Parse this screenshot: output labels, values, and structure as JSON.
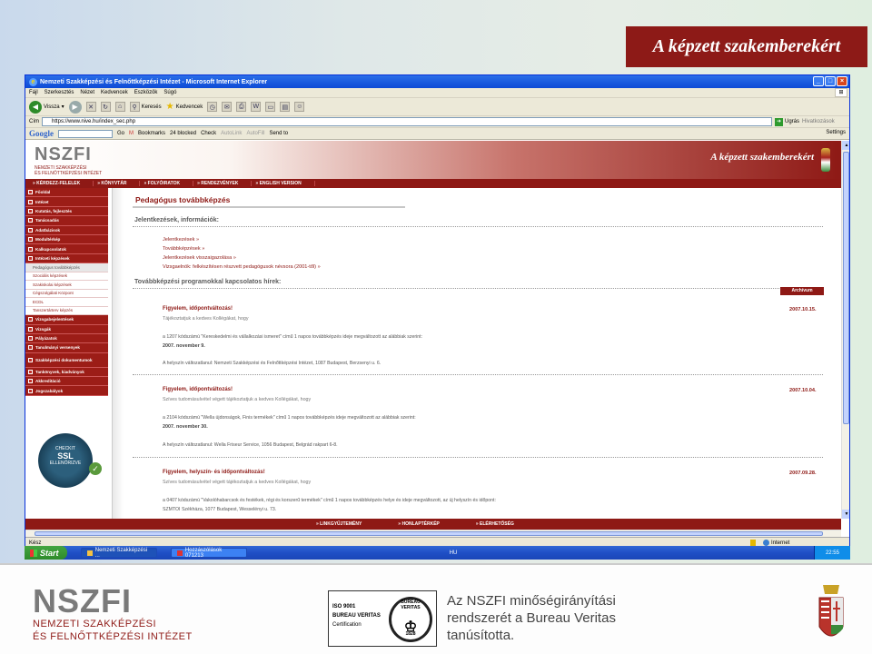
{
  "slide": {
    "title": "A képzett szakemberekért"
  },
  "window": {
    "title": "Nemzeti Szakképzési és Felnőttképzési Intézet - Microsoft Internet Explorer",
    "menu": [
      "Fájl",
      "Szerkesztés",
      "Nézet",
      "Kedvencek",
      "Eszközök",
      "Súgó"
    ],
    "toolbar": {
      "back": "Vissza",
      "search": "Keresés",
      "favorites": "Kedvencek"
    },
    "address": {
      "label": "Cím",
      "url": "https://www.nive.hu/index_sec.php",
      "go": "Ugrás",
      "links": "Hivatkozások"
    },
    "googlebar": {
      "logo": "Google",
      "go": "Go",
      "bookmarks": "Bookmarks",
      "blocked": "24 blocked",
      "check": "Check",
      "autolink": "AutoLink",
      "autofill": "AutoFill",
      "sendto": "Send to",
      "settings": "Settings"
    },
    "status": {
      "text": "Kész",
      "zone": "Internet"
    }
  },
  "site": {
    "logo_mark": "NSZ",
    "logo_mark2": "FI",
    "logo_sub1": "NEMZETI SZAKKÉPZÉSI",
    "logo_sub2": "ÉS FELNŐTTKÉPZÉSI INTÉZET",
    "tagline": "A képzett szakemberekért",
    "nav": [
      "KÉRDEZZ-FELELEK",
      "KÖNYVTÁR",
      "FOLYÓIRATOK",
      "RENDEZVÉNYEK",
      "ENGLISH VERSION"
    ],
    "sidebar": {
      "items_top": [
        "Főoldal",
        "Intézet",
        "Kutatás, fejlesztés",
        "Tanácsadás",
        "Adatbázisok",
        "Modultérkép",
        "Kalkupcsolatok",
        "Intézeti képzések"
      ],
      "subs": [
        "Pedagógus továbbképzés",
        "Szociális képzések",
        "Szakiskolai képzések",
        "Cégszolgálati Központ",
        "ECDL",
        "Tanszertárterv képzés"
      ],
      "items_bottom": [
        "Vizsgabejelentések",
        "Vizsgák",
        "Pályázatok",
        "Tanulmányi versenyek"
      ],
      "item_tall": "Szakképzési dokumentumok",
      "items_last": [
        "Tankönyvek, kiadványok",
        "Akkreditáció",
        "Jogszabályok"
      ],
      "ssl_top": "CHECKIT",
      "ssl_big": "SSL",
      "ssl_bottom": "ELLENŐRIZVE"
    },
    "content": {
      "h1": "Pedagógus továbbképzés",
      "section1": "Jelentkezések, információk:",
      "links": [
        "Jelentkezések »",
        "Továbbképzések »",
        "Jelentkezések visszaigazolása »",
        "Vizsgaelnök: felkészítésen részvett pedagógusok névsora (2001-től) »"
      ],
      "section2": "Továbbképzési programokkal kapcsolatos hírek:",
      "archive": "Archívum",
      "news": [
        {
          "title": "Figyelem, időpontváltozás!",
          "date": "2007.10.15.",
          "lead": "Tájékoztatjuk a kedves Kollégákat, hogy",
          "text1": "a 1207 kódszámú \"Kereskedelmi és vállalkozási ismeret\" című 1 napos továbbképzés ideje megváltozott az alábbiak szerint:",
          "bold1": "2007. november 9.",
          "text2": "A helyszín változatlanul: Nemzeti Szakképzési és Felnőttképzési Intézet, 1087 Budapest, Berzsenyi u. 6."
        },
        {
          "title": "Figyelem, időpontváltozás!",
          "date": "2007.10.04.",
          "lead": "Szíves tudomásulvétel végett tájékoztatjuk a kedves Kollégákat, hogy",
          "text1": "a 2104 kódszámú \"Wella újdonságok, Finis termékek\" című 1 napos továbbképzés ideje megváltozott az alábbiak szerint:",
          "bold1": "2007. november 30.",
          "text2": "A helyszín változatlanul: Wella Friseur Service, 1056 Budapest, Belgrád rakpart 6-8."
        },
        {
          "title": "Figyelem, helyszín- és időpontváltozás!",
          "date": "2007.09.28.",
          "lead": "Szíves tudomásulvétel végett tájékoztatjuk a kedves Kollégákat, hogy",
          "text1": "a 0407 kódszámú \"Vakolóhabarcsok és festékek, régi és korszerű termékek\" című 1 napos továbbképzés helye és ideje megváltozott, az új helyszín és időpont:",
          "bold1": "",
          "text2": "SZMTOI Székháza, 1077 Budapest, Wesselényi u. 73."
        }
      ]
    },
    "footer_nav": [
      "LINKGYŰJTEMÉNY",
      "HONLAPTÉRKÉP",
      "ELÉRHETŐSÉG"
    ]
  },
  "taskbar": {
    "start": "Start",
    "tasks": [
      "Nemzeti Szakképzési ...",
      "Hozzászólások 071213"
    ],
    "lang": "HU",
    "clock": "22:55"
  },
  "footer": {
    "logo_mark": "NSZ",
    "logo_mark2": "FI",
    "logo_sub1": "NEMZETI SZAKKÉPZÉSI",
    "logo_sub2": "ÉS FELNŐTTKÉPZÉSI INTÉZET",
    "iso": "ISO 9001",
    "bv": "BUREAU VERITAS",
    "cert": "Certification",
    "seal_top": "BUREAU VERITAS",
    "seal_year": "1828",
    "cert_line1": "Az NSZFI minőségirányítási",
    "cert_line2": "rendszerét a Bureau Veritas",
    "cert_line3": "tanúsította."
  },
  "colors": {
    "brand": "#8e1915",
    "link": "#8e1915"
  }
}
